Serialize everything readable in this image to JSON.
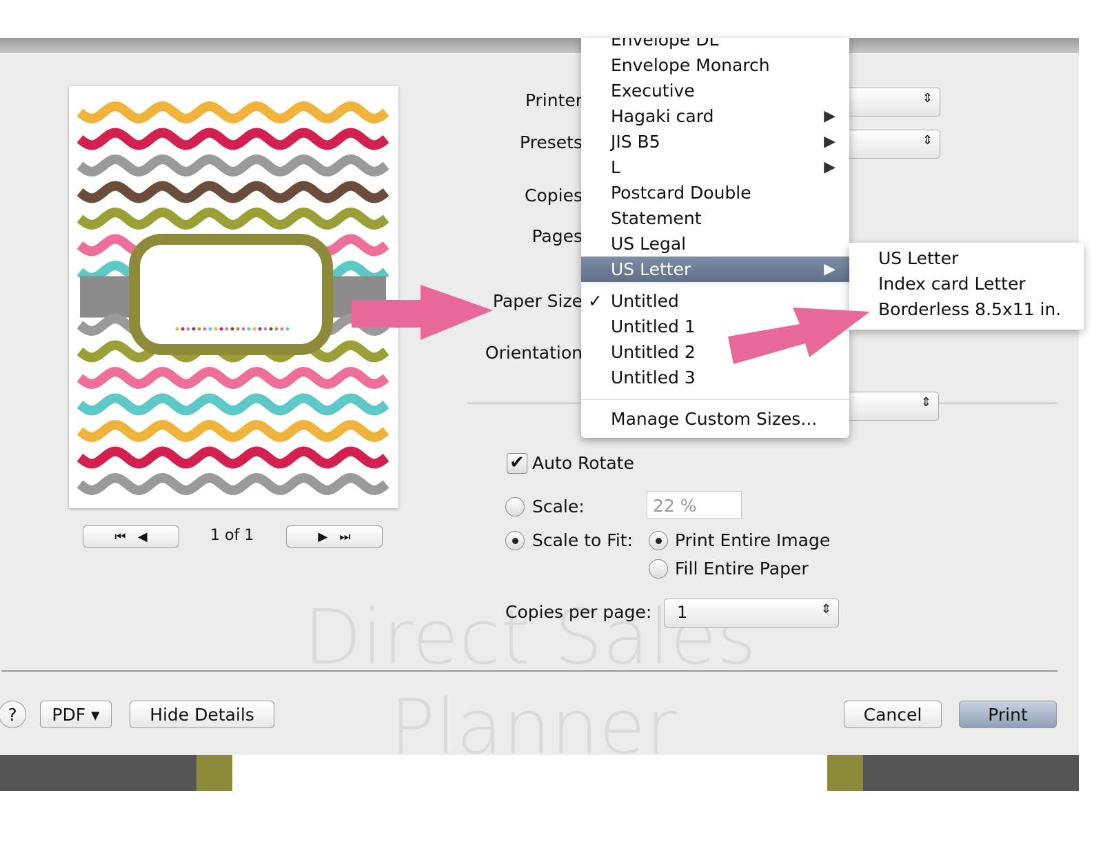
{
  "labels": {
    "printer": "Printer",
    "presets": "Presets",
    "copies": "Copies",
    "pages": "Pages",
    "paper_size": "Paper Size",
    "orientation": "Orientation"
  },
  "preview": {
    "page_indicator": "1 of 1",
    "wave_colors": [
      "#f0b43c",
      "#d4204e",
      "#9a9a9a",
      "#6b4c3b",
      "#9aa035",
      "#ee6f9a",
      "#5cc8c8"
    ]
  },
  "watermark": {
    "line1": "Direct Sales",
    "line2": "Planner"
  },
  "paper_menu": {
    "items": [
      {
        "label": "Envelope DL",
        "submenu": false
      },
      {
        "label": "Envelope Monarch",
        "submenu": false
      },
      {
        "label": "Executive",
        "submenu": false
      },
      {
        "label": "Hagaki card",
        "submenu": true
      },
      {
        "label": "JIS B5",
        "submenu": true
      },
      {
        "label": "L",
        "submenu": true
      },
      {
        "label": "Postcard Double",
        "submenu": false
      },
      {
        "label": "Statement",
        "submenu": false
      },
      {
        "label": "US Legal",
        "submenu": false
      },
      {
        "label": "US Letter",
        "submenu": true,
        "highlighted": true
      }
    ],
    "custom": [
      {
        "label": "Untitled",
        "checked": true
      },
      {
        "label": "Untitled 1"
      },
      {
        "label": "Untitled 2"
      },
      {
        "label": "Untitled 3"
      }
    ],
    "checkmark": "✓",
    "manage": "Manage Custom Sizes..."
  },
  "submenu": {
    "items": [
      "US Letter",
      "Index card Letter",
      "Borderless 8.5x11 in."
    ]
  },
  "options": {
    "auto_rotate": {
      "label": "Auto Rotate",
      "checked": true
    },
    "scale": {
      "label": "Scale:",
      "value": "22 %",
      "selected": false
    },
    "scale_to_fit": {
      "label": "Scale to Fit:",
      "selected": true
    },
    "print_entire_image": {
      "label": "Print Entire Image",
      "selected": true
    },
    "fill_entire_paper": {
      "label": "Fill Entire Paper",
      "selected": false
    },
    "copies_per_page": {
      "label": "Copies per page:",
      "value": "1"
    }
  },
  "footer": {
    "help": "?",
    "pdf": "PDF ▾",
    "hide_details": "Hide Details",
    "cancel": "Cancel",
    "print": "Print"
  },
  "arrow_color": "#e8689a"
}
